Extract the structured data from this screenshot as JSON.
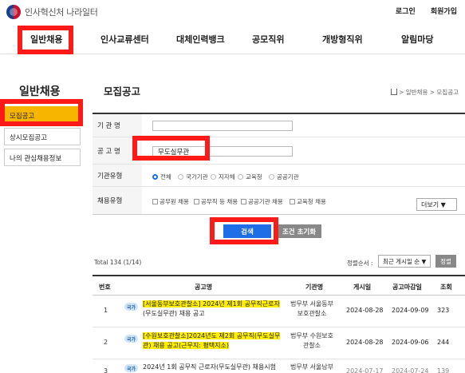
{
  "header": {
    "logo_text": "인사혁신처 나라일터",
    "login": "로그인",
    "signup": "회원가입"
  },
  "gnb": [
    "일반채용",
    "인사교류센터",
    "대체인력뱅크",
    "공모직위",
    "개방형직위",
    "알림마당"
  ],
  "sidebar": {
    "title": "일반채용",
    "items": [
      "모집공고",
      "상시모집공고",
      "나의 관심채용정보"
    ]
  },
  "main": {
    "title": "모집공고",
    "breadcrumb": "> 일반채용 > 모집공고"
  },
  "form": {
    "org_label": "기 관 명",
    "org_value": "",
    "notice_label": "공 고 명",
    "notice_value": "무도실무관",
    "org_type_label": "기관유형",
    "org_types": [
      "전체",
      "국가기관",
      "지자체",
      "교육청",
      "공공기관"
    ],
    "org_type_selected": "전체",
    "hire_type_label": "채용유형",
    "hire_types": [
      "공무원 채용",
      "공무직 등 채용",
      "공공기관 채용",
      "교육청 채용"
    ],
    "more_label": "더보기 ▼",
    "search_btn": "검색",
    "reset_btn": "조건 초기화"
  },
  "list": {
    "total": "Total 134 (1/14)",
    "sort_label": "정렬순서 :",
    "sort_value": "최근 게시일 순 ▼",
    "sort_btn": "정렬",
    "headers": [
      "번호",
      "공고명",
      "기관명",
      "게시일",
      "공고마감일",
      "조회"
    ],
    "rows": [
      {
        "no": "1",
        "badge": "국가",
        "title_mark": "[서울동부보호관찰소] 2024년 제1회 공무직근로자",
        "title_rest": "(무도실무관) 채용 공고",
        "org": "법무부 서울동부보호관찰소",
        "posted": "2024-08-28",
        "due": "2024-09-09",
        "views": "323"
      },
      {
        "no": "2",
        "badge": "국가",
        "title_mark": "[수원보호관찰소]2024년도 제2회 공무직(무도실무",
        "title_rest": "관) 채용 공고(근무지: 평택지소)",
        "org": "법무부 수원보호관찰소",
        "posted": "2024-08-28",
        "due": "2024-09-06",
        "views": "244"
      },
      {
        "no": "3",
        "badge": "국가",
        "title_mark": "",
        "title_rest": "2024년 1회 공무직 근로자(무도실무관) 채용시험",
        "org": "법무부 서울남부",
        "posted": "2024-07-17",
        "due": "2024-07-24",
        "views": "139"
      }
    ]
  }
}
